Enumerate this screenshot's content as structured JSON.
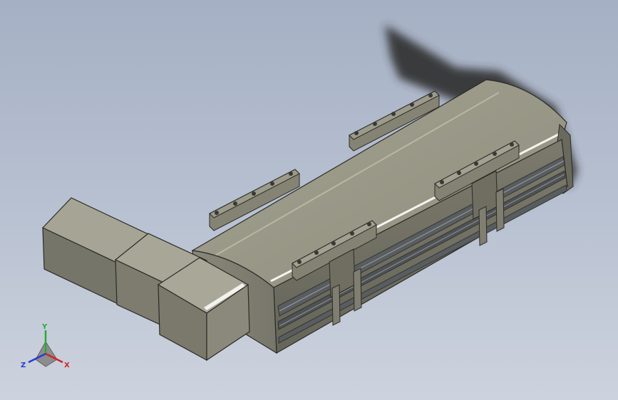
{
  "view": {
    "background_top": "#a5b0c4",
    "background_bottom": "#cdd3de",
    "model_body_color": "#8e8d7d",
    "model_shadow_color": "#2e2e2e",
    "rail_color": "#5a5d60"
  },
  "triad": {
    "x_label": "X",
    "y_label": "Y",
    "z_label": "Z",
    "x_color": "#d0242a",
    "y_color": "#2aa836",
    "z_color": "#2a3ad0"
  }
}
